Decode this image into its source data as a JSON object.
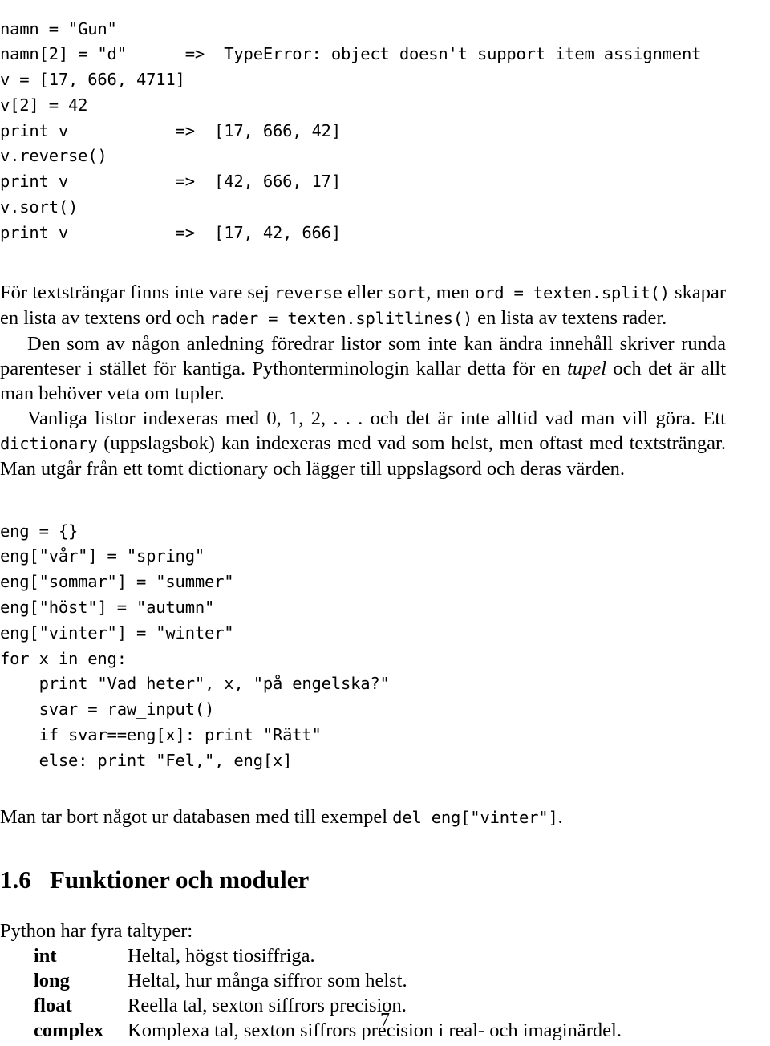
{
  "document": {
    "page_number": "7",
    "language": "sv"
  },
  "code_block_1": {
    "lines": [
      "namn = \"Gun\"",
      "namn[2] = \"d\"      =>  TypeError: object doesn't support item assignment",
      "v = [17, 666, 4711]",
      "v[2] = 42",
      "print v           =>  [17, 666, 42]",
      "v.reverse()",
      "print v           =>  [42, 666, 17]",
      "v.sort()",
      "print v           =>  [17, 42, 666]"
    ]
  },
  "paragraph_1": {
    "parts": [
      {
        "type": "text",
        "text": "För textsträngar finns inte vare sej "
      },
      {
        "type": "mono",
        "text": "reverse"
      },
      {
        "type": "text",
        "text": " eller "
      },
      {
        "type": "mono",
        "text": "sort"
      },
      {
        "type": "text",
        "text": ", men "
      },
      {
        "type": "mono",
        "text": "ord = texten.split()"
      },
      {
        "type": "text",
        "text": " skapar en lista av textens ord och "
      },
      {
        "type": "mono",
        "text": "rader = texten.splitlines()"
      },
      {
        "type": "text",
        "text": " en lista av textens rader."
      }
    ]
  },
  "paragraph_2": {
    "parts": [
      {
        "type": "text",
        "text": "Den som av någon anledning föredrar listor som inte kan ändra innehåll skriver runda parenteser i stället för kantiga. Pythonterminologin kallar detta för en "
      },
      {
        "type": "italic",
        "text": "tupel"
      },
      {
        "type": "text",
        "text": " och det är allt man behöver veta om tupler."
      }
    ]
  },
  "paragraph_3": {
    "parts": [
      {
        "type": "text",
        "text": "Vanliga listor indexeras med "
      },
      {
        "type": "math",
        "text": "0, 1, 2, . . ."
      },
      {
        "type": "text",
        "text": " och det är inte alltid vad man vill göra. Ett "
      },
      {
        "type": "mono",
        "text": "dictionary"
      },
      {
        "type": "text",
        "text": " (uppslagsbok) kan indexeras med vad som helst, men oftast med textsträngar. Man utgår från ett tomt dictionary och lägger till uppslagsord och deras värden."
      }
    ]
  },
  "code_block_2": {
    "lines": [
      "eng = {}",
      "eng[\"vår\"] = \"spring\"",
      "eng[\"sommar\"] = \"summer\"",
      "eng[\"höst\"] = \"autumn\"",
      "eng[\"vinter\"] = \"winter\"",
      "for x in eng:",
      "    print \"Vad heter\", x, \"på engelska?\"",
      "    svar = raw_input()",
      "    if svar==eng[x]: print \"Rätt\"",
      "    else: print \"Fel,\", eng[x]"
    ]
  },
  "paragraph_4": {
    "parts": [
      {
        "type": "text",
        "text": "Man tar bort något ur databasen med till exempel "
      },
      {
        "type": "mono",
        "text": "del eng[\"vinter\"]"
      },
      {
        "type": "text",
        "text": "."
      }
    ]
  },
  "section": {
    "number": "1.6",
    "title": "Funktioner och moduler"
  },
  "paragraph_5": {
    "parts": [
      {
        "type": "text",
        "text": "Python har fyra taltyper:"
      }
    ]
  },
  "type_list": {
    "items": [
      {
        "term": "int",
        "description": "Heltal, högst tiosiffriga."
      },
      {
        "term": "long",
        "description": "Heltal, hur många siffror som helst."
      },
      {
        "term": "float",
        "description": "Reella tal, sexton siffrors precision."
      },
      {
        "term": "complex",
        "description": "Komplexa tal, sexton siffrors precision i real- och imaginärdel."
      }
    ]
  }
}
